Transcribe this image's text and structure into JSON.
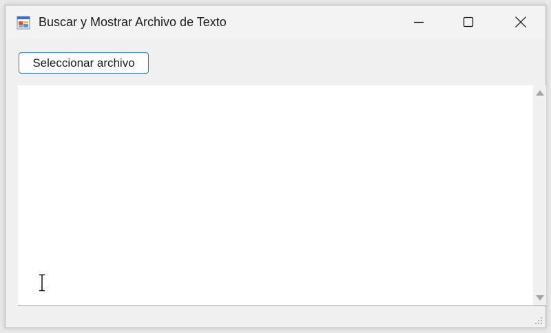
{
  "window": {
    "title": "Buscar y Mostrar Archivo de Texto",
    "icon": "winforms-app-icon",
    "controls": {
      "minimize_icon": "minimize-icon",
      "maximize_icon": "maximize-icon",
      "close_icon": "close-icon"
    }
  },
  "toolbar": {
    "select_file_label": "Seleccionar archivo"
  },
  "textbox": {
    "content": "",
    "scrollbar": {
      "up_icon": "scroll-up-arrow-icon",
      "down_icon": "scroll-down-arrow-icon"
    }
  },
  "colors": {
    "window_bg": "#f0f0f0",
    "titlebar_bg": "#f3f3f3",
    "accent_border": "#2c7ad6",
    "textbox_bg": "#ffffff"
  }
}
